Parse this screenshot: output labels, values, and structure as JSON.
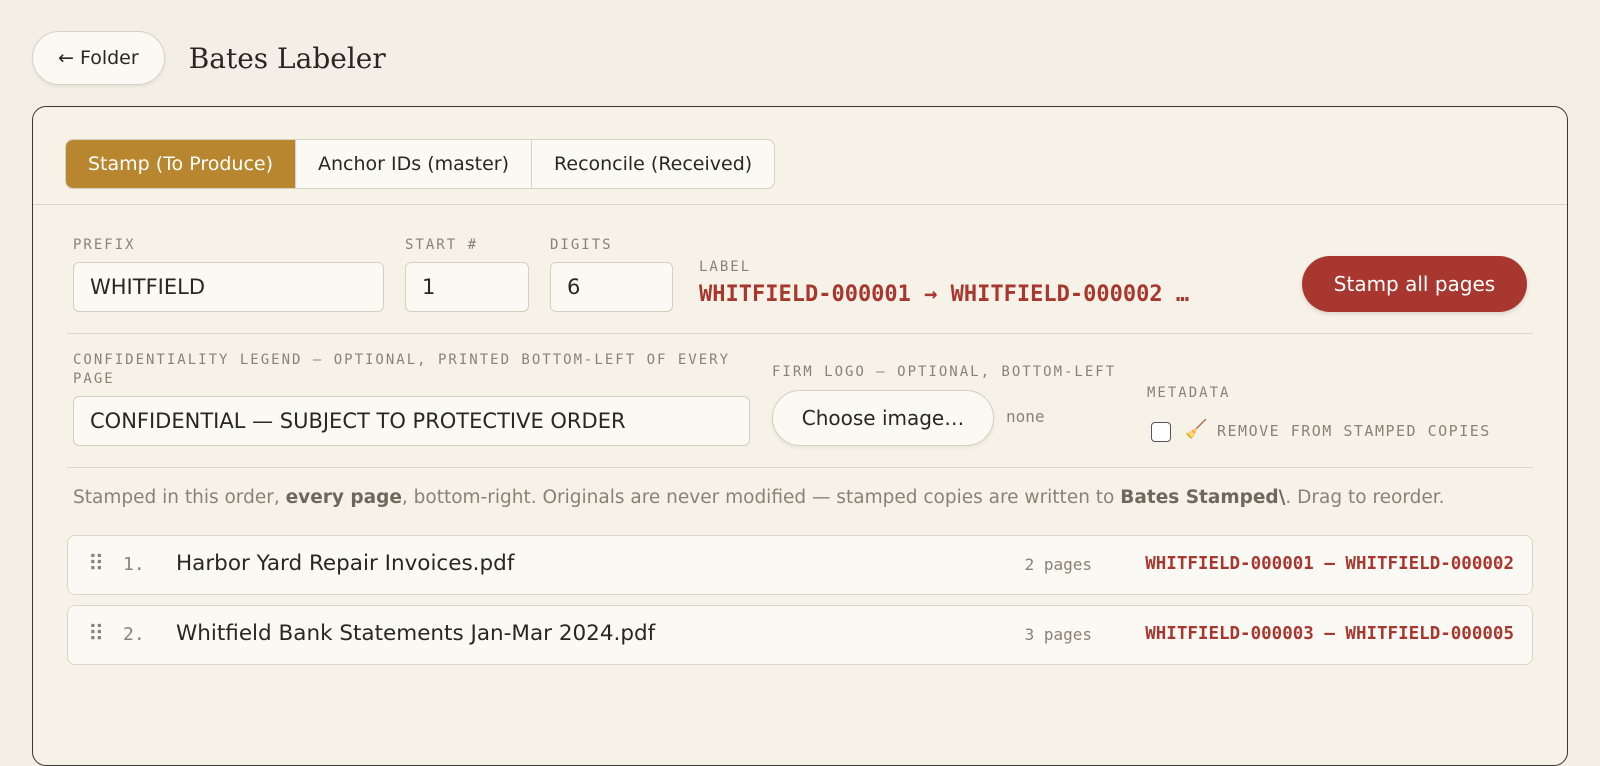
{
  "header": {
    "back_label": "← Folder",
    "title": "Bates Labeler"
  },
  "tabs": [
    {
      "label": "Stamp (To Produce)",
      "active": true
    },
    {
      "label": "Anchor IDs (master)",
      "active": false
    },
    {
      "label": "Reconcile (Received)",
      "active": false
    }
  ],
  "fields": {
    "prefix_label": "PREFIX",
    "prefix_value": "WHITFIELD",
    "start_label": "START #",
    "start_value": "1",
    "digits_label": "DIGITS",
    "digits_value": "6",
    "label_label": "LABEL",
    "label_preview": "WHITFIELD-000001 → WHITFIELD-000002 …",
    "stamp_button": "Stamp all pages"
  },
  "options": {
    "legend_label": "CONFIDENTIALITY LEGEND — OPTIONAL, PRINTED BOTTOM-LEFT OF EVERY PAGE",
    "legend_value": "CONFIDENTIAL — SUBJECT TO PROTECTIVE ORDER",
    "logo_label": "FIRM LOGO — OPTIONAL, BOTTOM-LEFT",
    "choose_button": "Choose image…",
    "logo_status": "none",
    "metadata_label": "METADATA",
    "metadata_checked": false,
    "metadata_option": "REMOVE FROM STAMPED COPIES",
    "metadata_icon": "broom-icon"
  },
  "note": {
    "part1": "Stamped in this order, ",
    "bold1": "every page",
    "part2": ", bottom-right. Originals are never modified — stamped copies are written to ",
    "bold2": "Bates Stamped\\",
    "part3": ". Drag to reorder."
  },
  "files": [
    {
      "index": "1.",
      "name": "Harbor Yard Repair Invoices.pdf",
      "pages": "2 pages",
      "range": "WHITFIELD-000001 – WHITFIELD-000002"
    },
    {
      "index": "2.",
      "name": "Whitfield Bank Statements Jan-Mar 2024.pdf",
      "pages": "3 pages",
      "range": "WHITFIELD-000003 – WHITFIELD-000005"
    }
  ],
  "colors": {
    "accent_gold": "#b8862e",
    "accent_red": "#a8382f",
    "background": "#f3efe6"
  }
}
